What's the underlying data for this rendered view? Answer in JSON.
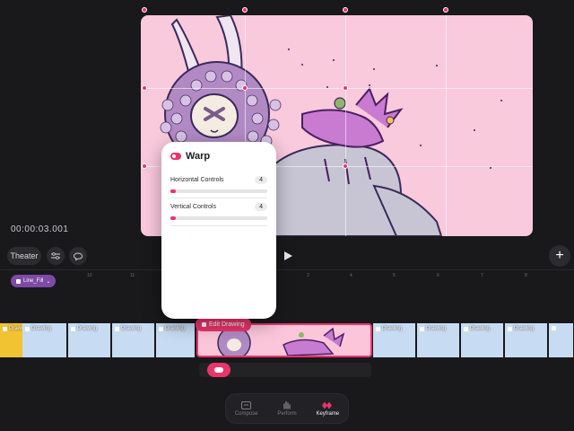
{
  "timecode": "00:00:03.001",
  "transport": {
    "theater_label": "Theater"
  },
  "ruler_ticks": [
    "10",
    "11",
    "3",
    "4",
    "5",
    "6",
    "7",
    "8"
  ],
  "layer_chip": {
    "label": "Line_Fill"
  },
  "timeline": {
    "clip_label": "Drawing",
    "selected_clip_label": "Edit Drawing"
  },
  "warp_panel": {
    "title": "Warp",
    "horizontal": {
      "label": "Horizontal Controls",
      "value": "4",
      "level": 0.05
    },
    "vertical": {
      "label": "Vertical Controls",
      "value": "4",
      "level": 0.05
    }
  },
  "tabs": [
    {
      "label": "Compose",
      "icon": "compose-icon",
      "active": false
    },
    {
      "label": "Perform",
      "icon": "perform-icon",
      "active": false
    },
    {
      "label": "Keyframe",
      "icon": "keyframe-icon",
      "active": true
    }
  ],
  "colors": {
    "accent": "#e8356b",
    "canvas_bg": "#f9c9dc",
    "layer_chip": "#7d4aa6"
  }
}
